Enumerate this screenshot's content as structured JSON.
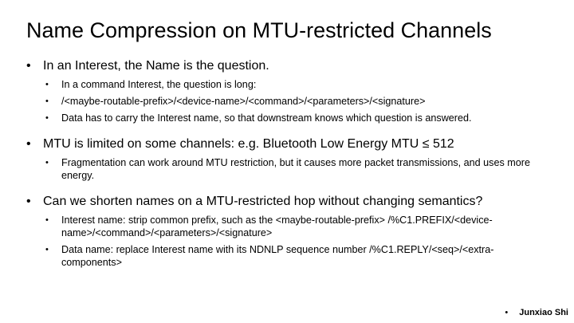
{
  "slide": {
    "title": "Name Compression on MTU-restricted Channels",
    "bullet_char": "•",
    "bullets": [
      {
        "text": "In an Interest, the Name is the question.",
        "sub": [
          {
            "text": "In a command Interest, the question is long:"
          },
          {
            "text": "/<maybe-routable-prefix>/<device-name>/<command>/<parameters>/<signature>"
          },
          {
            "text": "Data has to carry the Interest name, so that downstream knows which question is answered."
          }
        ]
      },
      {
        "text": "MTU is limited on some channels: e.g. Bluetooth Low Energy MTU ≤ 512",
        "sub": [
          {
            "text": "Fragmentation can work around MTU restriction, but it causes more packet transmissions, and uses more energy."
          }
        ]
      },
      {
        "text": "Can we shorten names on a MTU-restricted hop without changing semantics?",
        "sub": [
          {
            "text": "Interest name: strip common prefix, such as the <maybe-routable-prefix> /%C1.PREFIX/<device-name>/<command>/<parameters>/<signature>"
          },
          {
            "text": "Data name: replace Interest name with its NDNLP sequence number /%C1.REPLY/<seq>/<extra-components>"
          }
        ]
      }
    ],
    "footer": {
      "author": "Junxiao Shi"
    }
  }
}
